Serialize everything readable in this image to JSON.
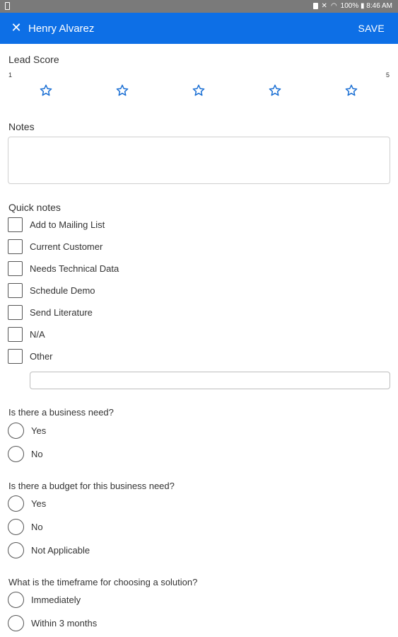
{
  "status_bar": {
    "text": "100% ▮ 8:46 AM"
  },
  "app_bar": {
    "close_glyph": "✕",
    "title": "Henry Alvarez",
    "save_label": "SAVE"
  },
  "lead_score": {
    "label": "Lead Score",
    "min_label": "1",
    "max_label": "5",
    "star_count": 5,
    "value": 0,
    "star_color": "#1a6fd4"
  },
  "notes": {
    "label": "Notes",
    "value": ""
  },
  "quick_notes": {
    "label": "Quick notes",
    "items": [
      "Add to Mailing List",
      "Current Customer",
      "Needs Technical Data",
      "Schedule Demo",
      "Send Literature",
      "N/A",
      "Other"
    ],
    "other_value": ""
  },
  "business_need": {
    "question": "Is there a business need?",
    "options": [
      "Yes",
      "No"
    ]
  },
  "budget": {
    "question": "Is there a budget for this business need?",
    "options": [
      "Yes",
      "No",
      "Not Applicable"
    ]
  },
  "timeframe": {
    "question": "What is the timeframe for choosing a solution?",
    "options": [
      "Immediately",
      "Within 3 months"
    ]
  }
}
